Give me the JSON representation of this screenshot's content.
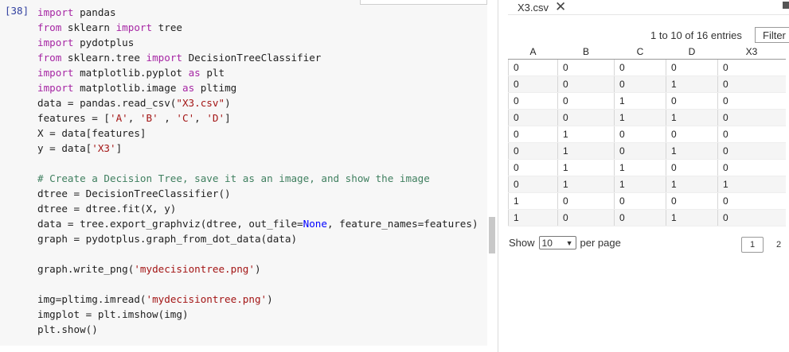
{
  "notebook": {
    "prompt": "[38]",
    "lines": [
      [
        {
          "t": "import",
          "c": "kw"
        },
        {
          "t": " pandas",
          "c": ""
        }
      ],
      [
        {
          "t": "from",
          "c": "kw"
        },
        {
          "t": " sklearn ",
          "c": ""
        },
        {
          "t": "import",
          "c": "kw"
        },
        {
          "t": " tree",
          "c": ""
        }
      ],
      [
        {
          "t": "import",
          "c": "kw"
        },
        {
          "t": " pydotplus",
          "c": ""
        }
      ],
      [
        {
          "t": "from",
          "c": "kw"
        },
        {
          "t": " sklearn.tree ",
          "c": ""
        },
        {
          "t": "import",
          "c": "kw"
        },
        {
          "t": " DecisionTreeClassifier",
          "c": ""
        }
      ],
      [
        {
          "t": "import",
          "c": "kw"
        },
        {
          "t": " matplotlib.pyplot ",
          "c": ""
        },
        {
          "t": "as",
          "c": "kw"
        },
        {
          "t": " plt",
          "c": ""
        }
      ],
      [
        {
          "t": "import",
          "c": "kw"
        },
        {
          "t": " matplotlib.image ",
          "c": ""
        },
        {
          "t": "as",
          "c": "kw"
        },
        {
          "t": " pltimg",
          "c": ""
        }
      ],
      [
        {
          "t": "data = pandas.read_csv(",
          "c": ""
        },
        {
          "t": "\"X3.csv\"",
          "c": "str"
        },
        {
          "t": ")",
          "c": ""
        }
      ],
      [
        {
          "t": "features = [",
          "c": ""
        },
        {
          "t": "'A'",
          "c": "str"
        },
        {
          "t": ", ",
          "c": ""
        },
        {
          "t": "'B'",
          "c": "str"
        },
        {
          "t": " , ",
          "c": ""
        },
        {
          "t": "'C'",
          "c": "str"
        },
        {
          "t": ", ",
          "c": ""
        },
        {
          "t": "'D'",
          "c": "str"
        },
        {
          "t": "]",
          "c": ""
        }
      ],
      [
        {
          "t": "X = data[features]",
          "c": ""
        }
      ],
      [
        {
          "t": "y = data[",
          "c": ""
        },
        {
          "t": "'X3'",
          "c": "str"
        },
        {
          "t": "]",
          "c": ""
        }
      ],
      [
        {
          "t": "",
          "c": ""
        }
      ],
      [
        {
          "t": "# Create a Decision Tree, save it as an image, and show the image",
          "c": "cm"
        }
      ],
      [
        {
          "t": "dtree = DecisionTreeClassifier()",
          "c": ""
        }
      ],
      [
        {
          "t": "dtree = dtree.fit(X, y)",
          "c": ""
        }
      ],
      [
        {
          "t": "data = tree.export_graphviz(dtree, out_file=",
          "c": ""
        },
        {
          "t": "None",
          "c": "kwc"
        },
        {
          "t": ", feature_names=features)",
          "c": ""
        }
      ],
      [
        {
          "t": "graph = pydotplus.graph_from_dot_data(data)",
          "c": ""
        }
      ],
      [
        {
          "t": "",
          "c": ""
        }
      ],
      [
        {
          "t": "graph.write_png(",
          "c": ""
        },
        {
          "t": "'mydecisiontree.png'",
          "c": "str"
        },
        {
          "t": ")",
          "c": ""
        }
      ],
      [
        {
          "t": "",
          "c": ""
        }
      ],
      [
        {
          "t": "img=pltimg.imread(",
          "c": ""
        },
        {
          "t": "'mydecisiontree.png'",
          "c": "str"
        },
        {
          "t": ")",
          "c": ""
        }
      ],
      [
        {
          "t": "imgplot = plt.imshow(img)",
          "c": ""
        }
      ],
      [
        {
          "t": "plt.show()",
          "c": ""
        }
      ]
    ]
  },
  "viewer": {
    "tab_title": "X3.csv",
    "close_glyph": "✕",
    "entries_text": "1 to 10 of 16 entries",
    "filter_label": "Filter",
    "columns": [
      "A",
      "B",
      "C",
      "D",
      "X3"
    ],
    "rows": [
      [
        "0",
        "0",
        "0",
        "0",
        "0"
      ],
      [
        "0",
        "0",
        "0",
        "1",
        "0"
      ],
      [
        "0",
        "0",
        "1",
        "0",
        "0"
      ],
      [
        "0",
        "0",
        "1",
        "1",
        "0"
      ],
      [
        "0",
        "1",
        "0",
        "0",
        "0"
      ],
      [
        "0",
        "1",
        "0",
        "1",
        "0"
      ],
      [
        "0",
        "1",
        "1",
        "0",
        "0"
      ],
      [
        "0",
        "1",
        "1",
        "1",
        "1"
      ],
      [
        "1",
        "0",
        "0",
        "0",
        "0"
      ],
      [
        "1",
        "0",
        "0",
        "1",
        "0"
      ]
    ],
    "show_label": "Show",
    "page_size": "10",
    "per_page_label": "per page",
    "current_page": "1",
    "next_page": "2"
  }
}
